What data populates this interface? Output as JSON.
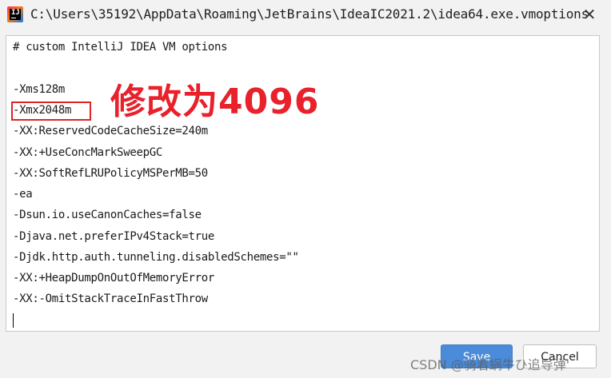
{
  "window": {
    "title": "C:\\Users\\35192\\AppData\\Roaming\\JetBrains\\IdeaIC2021.2\\idea64.exe.vmoptions",
    "close_glyph": "✕",
    "app_icon": "intellij-idea-icon"
  },
  "editor": {
    "lines": [
      "# custom IntelliJ IDEA VM options",
      "",
      "-Xms128m",
      "-Xmx2048m",
      "-XX:ReservedCodeCacheSize=240m",
      "-XX:+UseConcMarkSweepGC",
      "-XX:SoftRefLRUPolicyMSPerMB=50",
      "-ea",
      "-Dsun.io.useCanonCaches=false",
      "-Djava.net.preferIPv4Stack=true",
      "-Djdk.http.auth.tunneling.disabledSchemes=\"\"",
      "-XX:+HeapDumpOnOutOfMemoryError",
      "-XX:-OmitStackTraceInFastThrow"
    ]
  },
  "annotation": {
    "text": "修改为4096",
    "color": "#e8212b"
  },
  "buttons": {
    "save_label": "Save",
    "cancel_label": "Cancel"
  },
  "watermark": {
    "text": "CSDN @骑着蜗牛ひ追导弹'"
  }
}
